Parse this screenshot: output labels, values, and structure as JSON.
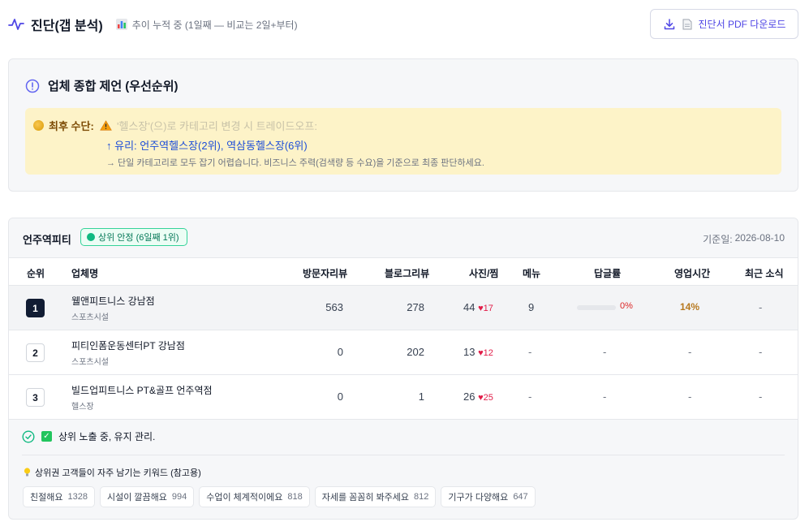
{
  "header": {
    "title": "진단(갭 분석)",
    "subtitle": "추이 누적 중 (1일째 — 비교는 2일+부터)",
    "pdf_button": "진단서 PDF 다운로드"
  },
  "recommendation": {
    "title": "업체 종합 제언 (우선순위)",
    "last_resort_label": "최후 수단:",
    "warning_text": "'헬스장'(으)로 카테고리 변경 시 트레이드오프:",
    "pro_text": "↑ 유리: 언주역헬스장(2위), 역삼동헬스장(6위)",
    "note_text": "→ 단일 카테고리로 모두 잡기 어렵습니다. 비즈니스 주력(검색량 등 수요)을 기준으로 최종 판단하세요."
  },
  "ranking": {
    "business_name": "언주역피티",
    "badge": "상위 안정 (6일째 1위)",
    "base_date_label": "기준일:",
    "base_date": "2026-08-10",
    "columns": {
      "rank": "순위",
      "name": "업체명",
      "visitor_reviews": "방문자리뷰",
      "blog_reviews": "블로그리뷰",
      "photos": "사진/찜",
      "menu": "메뉴",
      "reply_rate": "답글률",
      "hours": "영업시간",
      "news": "최근 소식"
    },
    "rows": [
      {
        "rank": "1",
        "name": "웰앤피트니스 강남점",
        "category": "스포츠시설",
        "visitor_reviews": "563",
        "blog_reviews": "278",
        "photos": "44",
        "likes": "♥17",
        "menu": "9",
        "reply_rate": "0%",
        "reply_rate_value": 0,
        "hours": "14%",
        "news": "-"
      },
      {
        "rank": "2",
        "name": "피티인폼운동센터PT 강남점",
        "category": "스포츠시설",
        "visitor_reviews": "0",
        "blog_reviews": "202",
        "photos": "13",
        "likes": "♥12",
        "menu": "-",
        "reply_rate": "-",
        "hours": "-",
        "news": "-"
      },
      {
        "rank": "3",
        "name": "빌드업피트니스 PT&골프 언주역점",
        "category": "헬스장",
        "visitor_reviews": "0",
        "blog_reviews": "1",
        "photos": "26",
        "likes": "♥25",
        "menu": "-",
        "reply_rate": "-",
        "hours": "-",
        "news": "-"
      }
    ],
    "status": "상위 노출 중, 유지 관리.",
    "keywords_title": "상위권 고객들이 자주 남기는 키워드 (참고용)",
    "keywords": [
      {
        "text": "친절해요",
        "count": "1328"
      },
      {
        "text": "시설이 깔끔해요",
        "count": "994"
      },
      {
        "text": "수업이 체계적이에요",
        "count": "818"
      },
      {
        "text": "자세를 꼼꼼히 봐주세요",
        "count": "812"
      },
      {
        "text": "기구가 다양해요",
        "count": "647"
      }
    ]
  },
  "colors": {
    "accent": "#4f46e5",
    "warning_bg": "#fdf3c8",
    "badge_green": "#10b981",
    "rank_first_bg": "#111c33",
    "heart": "#e11d48"
  }
}
